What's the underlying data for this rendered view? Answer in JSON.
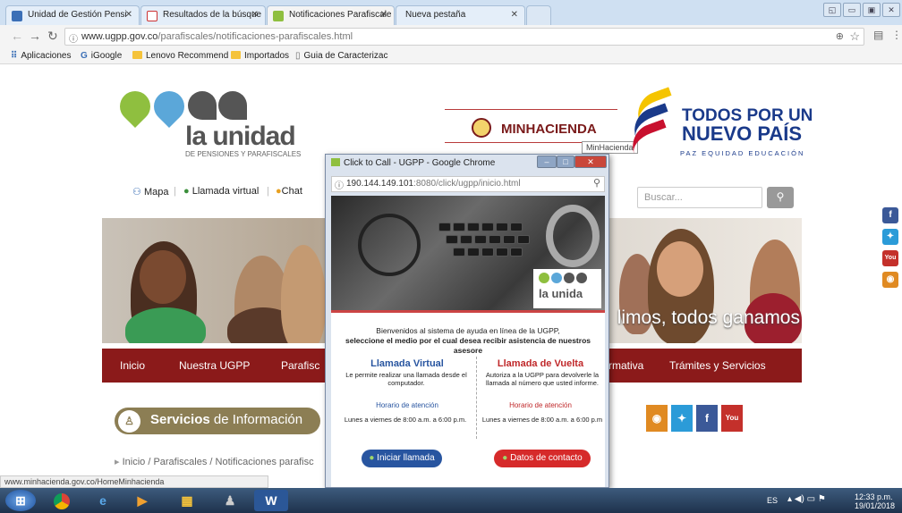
{
  "browser": {
    "tabs": [
      {
        "label": "Unidad de Gestión Pensi"
      },
      {
        "label": "Resultados de la búsque"
      },
      {
        "label": "Notificaciones Parafiscale"
      },
      {
        "label": "Nueva pestaña"
      }
    ],
    "address": {
      "domain": "www.ugpp.gov.co",
      "path": "/parafiscales/notificaciones-parafiscales.html"
    },
    "bookmarks": [
      {
        "label": "Aplicaciones"
      },
      {
        "label": "iGoogle"
      },
      {
        "label": "Lenovo Recommend"
      },
      {
        "label": "Importados"
      },
      {
        "label": "Guia de Caracterizac"
      }
    ],
    "status_url": "www.minhacienda.gov.co/HomeMinhacienda"
  },
  "site": {
    "logo_title": "la unidad",
    "logo_subtitle": "DE PENSIONES Y PARAFISCALES",
    "minhacienda": "MINHACIENDA",
    "tooltip": "MinHacienda",
    "gov_line1": "TODOS POR UN",
    "gov_line2": "NUEVO PAÍS",
    "gov_tagline": "PAZ  EQUIDAD  EDUCACIÓN",
    "top_links": {
      "mapa": "Mapa",
      "llamada": "Llamada virtual",
      "chat": "Chat"
    },
    "search_placeholder": "Buscar...",
    "banner_text": "limos, todos ganamos",
    "nav": [
      "Inicio",
      "Nuestra UGPP",
      "Parafisc",
      "rmativa",
      "Trámites y Servicios"
    ],
    "servicios_bold": "Servicios",
    "servicios_rest": " de Información",
    "breadcrumb": "Inicio / Parafiscales / Notificaciones parafisc"
  },
  "popup": {
    "title": "Click to Call - UGPP - Google Chrome",
    "url_host": "190.144.149.101",
    "url_rest": ":8080/click/ugpp/inicio.html",
    "logo_text": "la unida",
    "welcome_line1": "Bienvenidos al sistema de ayuda en línea de la UGPP,",
    "welcome_line2": "seleccione el medio por el cual desea recibir asistencia de nuestros asesore",
    "left": {
      "title": "Llamada Virtual",
      "desc": "Le permite realizar una llamada desde el computador.",
      "hours_label": "Horario de atención",
      "hours": "Lunes a viernes de 8:00 a.m. a 6:00 p.m.",
      "button": "Iniciar llamada"
    },
    "right": {
      "title": "Llamada de Vuelta",
      "desc": "Autoriza a la UGPP para devolverle la llamada al número que usted informe.",
      "hours_label": "Horario de atención",
      "hours": "Lunes a viernes de 8:00 a.m. a 6:00 p.m",
      "button": "Datos de contacto"
    }
  },
  "taskbar": {
    "lang": "ES",
    "time": "12:33 p.m.",
    "date": "19/01/2018"
  },
  "colors": {
    "accent_red": "#8b1a1a",
    "ugpp_green": "#8fbf3f",
    "ugpp_blue": "#5ba7d9",
    "servicios": "#8c7e54"
  }
}
